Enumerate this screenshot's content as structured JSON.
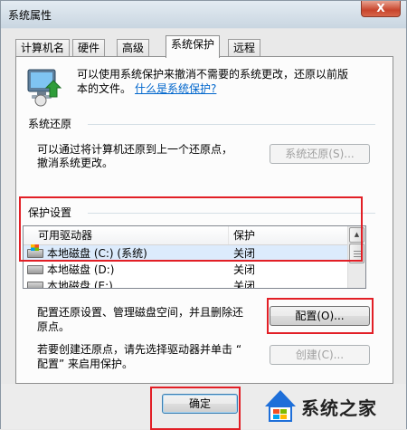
{
  "window": {
    "title": "系统属性",
    "close_label": "X"
  },
  "tabs": [
    {
      "label": "计算机名"
    },
    {
      "label": "硬件"
    },
    {
      "label": "高级"
    },
    {
      "label": "系统保护",
      "active": true
    },
    {
      "label": "远程"
    }
  ],
  "intro": {
    "line1": "可以使用系统保护来撤消不需要的系统更改，还原以前版",
    "line2": "本的文件。",
    "link": "什么是系统保护?"
  },
  "restore": {
    "heading": "系统还原",
    "line1": "可以通过将计算机还原到上一个还原点，",
    "line2": "撤消系统更改。",
    "button": "系统还原(S)..."
  },
  "protection": {
    "heading": "保护设置",
    "columns": [
      "可用驱动器",
      "保护"
    ],
    "rows": [
      {
        "drive": "本地磁盘 (C:) (系统)",
        "status": "关闭",
        "system": true
      },
      {
        "drive": "本地磁盘 (D:)",
        "status": "关闭",
        "system": false
      },
      {
        "drive": "本地磁盘 (E:)",
        "status": "关闭",
        "system": false
      }
    ]
  },
  "configure": {
    "line1": "配置还原设置、管理磁盘空间，并且删除还",
    "line2": "原点。",
    "button": "配置(O)..."
  },
  "create": {
    "line1": "若要创建还原点，请先选择驱动器并单击 “",
    "line2": "配置” 来启用保护。",
    "button": "创建(C)..."
  },
  "footer": {
    "ok_button": "确定"
  },
  "watermark": {
    "text": "系统之家"
  },
  "colors": {
    "highlight": "#e21f26",
    "link": "#0066cc",
    "selected_row": "#dcebfc"
  }
}
